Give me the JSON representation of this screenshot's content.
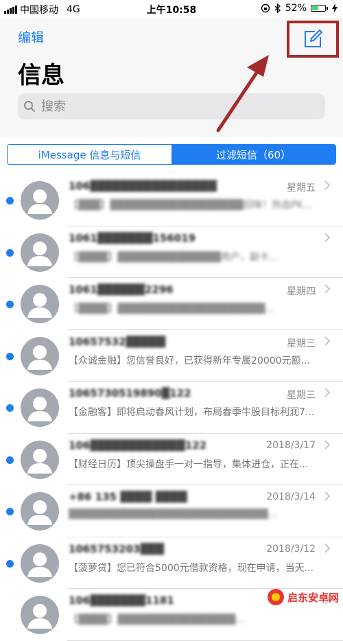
{
  "status_bar": {
    "carrier": "中国移动",
    "network": "4G",
    "time": "上午10:58",
    "battery": "52%",
    "battery_level": 0.52
  },
  "header": {
    "edit_label": "编辑",
    "title": "信息",
    "search_placeholder": "搜索"
  },
  "tabs": [
    {
      "label": "iMessage 信息与短信",
      "active": false
    },
    {
      "label": "过滤短信（60）",
      "active": true
    }
  ],
  "messages": [
    {
      "sender": "106▓▓▓▓▓▓▓▓▓▓▓▓▓▓▓▓",
      "date": "星期五",
      "preview": "【▓▓▓】▓▓▓▓▓▓▓▓▓▓▓▓▓▓▓▓▓▓回味！热血PK...",
      "unread": true
    },
    {
      "sender": "1061▓▓▓▓▓▓▓156019",
      "date": "",
      "preview": "【▓▓▓▓】▓▓▓▓▓▓▓▓▓▓▓▓▓▓用户，副卡...",
      "unread": true
    },
    {
      "sender": "1061▓▓▓▓▓▓2296",
      "date": "星期四",
      "preview": "【▓▓▓▓】▓▓▓▓▓▓▓▓▓▓▓▓▓▓▓▓▓▓▓▓...",
      "unread": true
    },
    {
      "sender": "10657532▓▓▓▓▓",
      "date": "星期三",
      "preview": "【众诚金融】您信誉良好，已获得新年专属20000元额...",
      "unread": true
    },
    {
      "sender": "1065730519890▓122",
      "date": "星期三",
      "preview": "【金融客】即将启动春风计划，布局春季牛股目标利润7...",
      "unread": true
    },
    {
      "sender": "106▓▓▓▓▓▓▓▓▓▓▓▓122",
      "date": "2018/3/17",
      "preview": "【财经日历】顶尖操盘手一对一指导，集体进仓，正在...",
      "unread": true
    },
    {
      "sender": "+86 135 ▓▓▓▓ ▓▓▓▓",
      "date": "2018/3/14",
      "preview": "▓▓▓▓▓▓▓▓▓▓▓▓▓▓▓▓▓▓▓▓▓▓▓▓▓▓▓...",
      "unread": true
    },
    {
      "sender": "1065753203▓▓▓",
      "date": "2018/3/12",
      "preview": "【菠萝贷】您已符合5000元借款资格，现在申请，当天...",
      "unread": true
    },
    {
      "sender": "106▓▓▓▓▓▓▓1181",
      "date": "",
      "preview": "【▓▓▓▓】▓▓▓▓▓▓▓▓▓▓▓▓▓▓▓▓...",
      "unread": false
    }
  ],
  "watermark": {
    "text": "启东安卓网"
  },
  "colors": {
    "accent": "#1e7df0",
    "annotation": "#a52a2a",
    "header_bg": "#f7f7f7"
  }
}
